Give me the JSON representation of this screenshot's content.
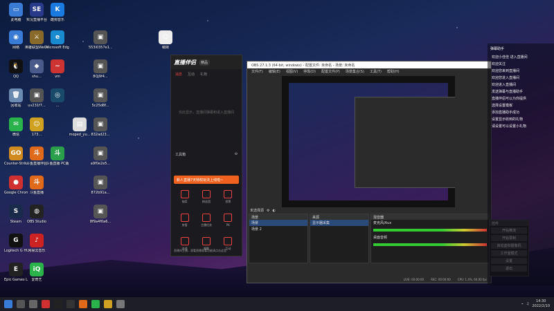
{
  "desktop_icons": [
    {
      "label": "此电脑",
      "icon": "computer-icon",
      "color": "#3a7bd5",
      "glyph": "▭"
    },
    {
      "label": "实况直播平台",
      "icon": "se-icon",
      "color": "#2a3a8a",
      "glyph": "SE"
    },
    {
      "label": "酷狗音乐",
      "icon": "kugou-icon",
      "color": "#1a7ae0",
      "glyph": "K"
    },
    {
      "label": "网络",
      "icon": "network-icon",
      "color": "#3a7bd5",
      "glyph": "◉"
    },
    {
      "label": "英雄联盟WeGame版",
      "icon": "lol-icon",
      "color": "#8a6a2a",
      "glyph": "⚔"
    },
    {
      "label": "Microsoft Edge",
      "icon": "edge-icon",
      "color": "#1a8ad0",
      "glyph": "e"
    },
    {
      "label": "QQ",
      "icon": "qq-icon",
      "color": "#111",
      "glyph": "🐧"
    },
    {
      "label": "shu...",
      "icon": "app-icon",
      "color": "#4a5a8a",
      "glyph": "◆"
    },
    {
      "label": "vm",
      "icon": "vm-icon",
      "color": "#c33",
      "glyph": "~"
    },
    {
      "label": "回收站",
      "icon": "recycle-bin-icon",
      "color": "#6a8ab0",
      "glyph": "🗑"
    },
    {
      "label": "uv231f7...",
      "icon": "file-icon",
      "color": "#555",
      "glyph": "▣"
    },
    {
      "label": "...",
      "icon": "app-icon",
      "color": "#1a4a6a",
      "glyph": "◎"
    },
    {
      "label": "微信",
      "icon": "wechat-icon",
      "color": "#2ab34a",
      "glyph": "✉"
    },
    {
      "label": "173...",
      "icon": "app-icon",
      "color": "#d0a020",
      "glyph": "☺"
    },
    {
      "label": "Counter-Strike GO",
      "icon": "csgo-icon",
      "color": "#d08a20",
      "glyph": "GO"
    },
    {
      "label": "斗鱼直播伴侣",
      "icon": "douyu-icon",
      "color": "#e06a1a",
      "glyph": "斗"
    },
    {
      "label": "斗鱼直播 PC版",
      "icon": "douyu-pc-icon",
      "color": "#2aa04a",
      "glyph": "斗"
    },
    {
      "label": "Google Chrome",
      "icon": "chrome-icon",
      "color": "#d03030",
      "glyph": "●"
    },
    {
      "label": "斗鱼直播",
      "icon": "douyu-live-icon",
      "color": "#e06a1a",
      "glyph": "斗"
    },
    {
      "label": "Steam",
      "icon": "steam-icon",
      "color": "#1a2a4a",
      "glyph": "S"
    },
    {
      "label": "OBS Studio",
      "icon": "obs-icon",
      "color": "#222",
      "glyph": "◍"
    },
    {
      "label": "Logitech G HUB",
      "icon": "logitech-icon",
      "color": "#111",
      "glyph": "G"
    },
    {
      "label": "网易云音乐",
      "icon": "netease-icon",
      "color": "#c22",
      "glyph": "♪"
    },
    {
      "label": "Epic Games Launcher",
      "icon": "epic-icon",
      "color": "#222",
      "glyph": "E"
    },
    {
      "label": "爱奇艺",
      "icon": "iqiyi-icon",
      "color": "#2ab34a",
      "glyph": "iQ"
    },
    {
      "label": "553i0357e1...",
      "icon": "file-icon",
      "color": "#555",
      "glyph": "▣"
    },
    {
      "label": "8Qj9f4...",
      "icon": "file-icon",
      "color": "#555",
      "glyph": "▣"
    },
    {
      "label": "5c25d8f...",
      "icon": "file-icon",
      "color": "#555",
      "glyph": "▣"
    },
    {
      "label": "832ad23...",
      "icon": "file-icon",
      "color": "#555",
      "glyph": "▣"
    },
    {
      "label": "a9f0e2e5...",
      "icon": "file-icon",
      "color": "#555",
      "glyph": "▣"
    },
    {
      "label": "872b91a...",
      "icon": "file-icon",
      "color": "#555",
      "glyph": "▣"
    },
    {
      "label": "8f9a4f0a6...",
      "icon": "file-icon",
      "color": "#555",
      "glyph": "▣"
    },
    {
      "label": "moped_yu...",
      "icon": "image-icon",
      "color": "#ddd",
      "glyph": "▤"
    },
    {
      "label": "萌妹",
      "icon": "image-icon",
      "color": "#eee",
      "glyph": "☺"
    }
  ],
  "assistant": {
    "logo": "直播伴侣",
    "tag": "精品",
    "tabs": [
      "消息",
      "互动",
      "礼物"
    ],
    "empty_text": "仅此显示，直播间弹幕和进入直播间",
    "tools_title": "工具箱",
    "banner": "新人直播7天特权玩法上线啦~",
    "tools": [
      "抽奖",
      "粉丝团",
      "投票",
      "房管",
      "主播任务",
      "PK",
      "连线",
      "唱歌",
      "互动"
    ],
    "footer": "直播间主播，观看直播观看功能请点击这里"
  },
  "obs": {
    "title": "OBS 27.1.3 (64-bit, windows) - 配置文件: 未命名 - 场景: 未命名",
    "menu": [
      "文件(F)",
      "编辑(E)",
      "视图(V)",
      "停靠(D)",
      "配置文件(P)",
      "场景集合(S)",
      "工具(T)",
      "帮助(H)"
    ],
    "scenes_header": "场景",
    "scenes": [
      "场景",
      "场景 2"
    ],
    "sources_header": "来源",
    "sources": [
      "显示器采集"
    ],
    "mixer_header": "混音器",
    "mixer": [
      "麦克风/Aux",
      "桌面音频"
    ],
    "controls_header": "控件",
    "controls": [
      "开始推流",
      "开始录制",
      "启动虚拟摄像机",
      "工作室模式",
      "设置",
      "退出"
    ],
    "scene_label": "未选择源",
    "status": [
      "LIVE: 00:00:00",
      "REC: 00:00:00",
      "CPU: 1.4%, 60.00 fps"
    ]
  },
  "chat": {
    "title": "弹幕助手",
    "messages": [
      {
        "text": "欢迎小佳佳 进入直播间",
        "red": false
      },
      {
        "text": "欢迎关注 ",
        "red": false
      },
      {
        "text": "欢迎您来到直播间",
        "red": false
      },
      {
        "text": "欢迎您进入直播间",
        "red": false
      },
      {
        "text": "欢迎进入直播间",
        "red": false
      },
      {
        "text": "发送弹幕与直播助手",
        "red": false
      },
      {
        "text": "直播伴侣可以为你提供",
        "red": false
      },
      {
        "text": "选择设置模板",
        "red": false
      },
      {
        "text": "添加直播助手成功",
        "red": false
      },
      {
        "text": "设置显示收到的礼物",
        "red": false
      },
      {
        "text": "请设置可以设置小礼物",
        "red": false
      }
    ]
  },
  "taskbar": {
    "apps": [
      "start",
      "search",
      "taskview",
      "chrome",
      "qq",
      "obs",
      "douyu",
      "wechat",
      "explorer",
      "settings"
    ],
    "time": "14:30",
    "date": "2022/2/10"
  }
}
